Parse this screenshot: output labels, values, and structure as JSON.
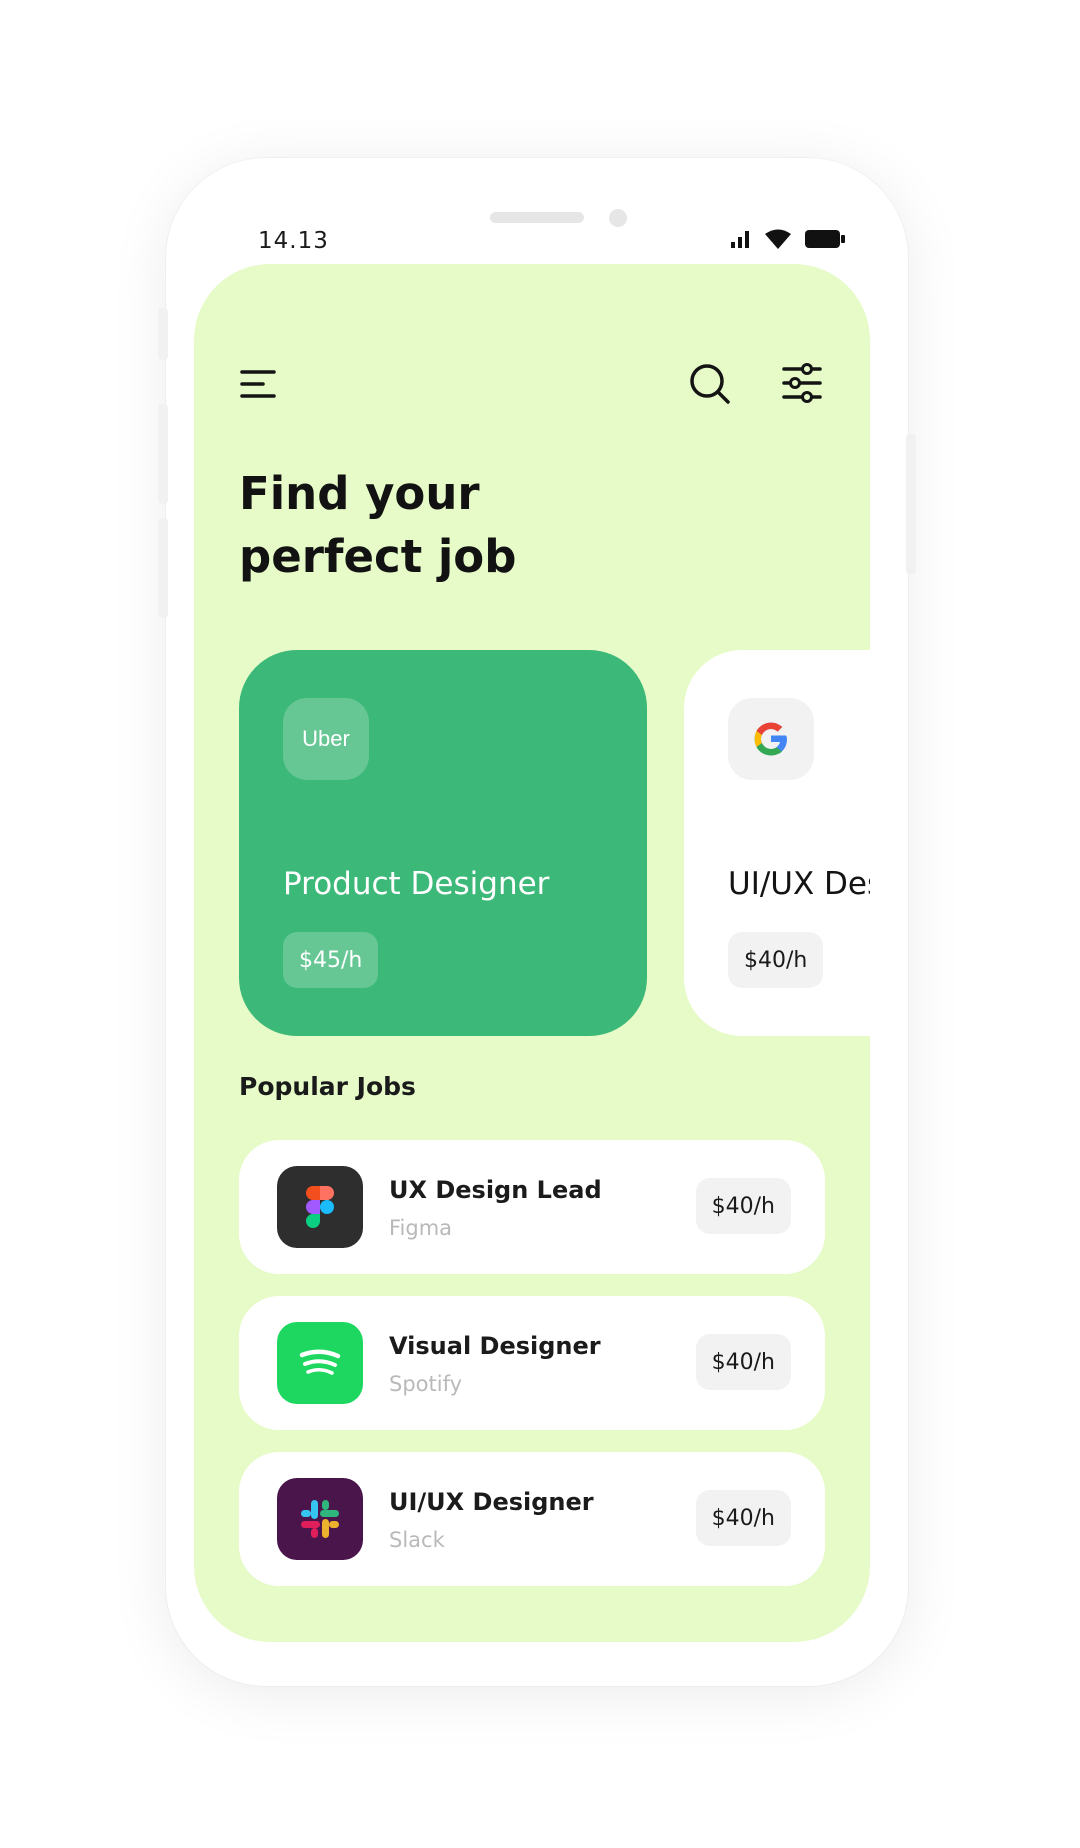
{
  "status_bar": {
    "time": "14.13",
    "icons": [
      "signal-icon",
      "wifi-icon",
      "battery-icon"
    ]
  },
  "header": {
    "menu_icon": "menu-icon",
    "search_icon": "search-icon",
    "filter_icon": "sliders-icon"
  },
  "hero": {
    "title_line1": "Find your",
    "title_line2": "perfect job"
  },
  "featured_jobs": [
    {
      "company_logo_text": "Uber",
      "role": "Product Designer",
      "rate": "$45/h",
      "card_color": "#3cb878"
    },
    {
      "company_logo": "google-logo-icon",
      "role": "UI/UX Designer",
      "rate": "$40/h",
      "card_color": "#ffffff"
    }
  ],
  "popular": {
    "section_title": "Popular Jobs",
    "jobs": [
      {
        "title": "UX Design Lead",
        "company": "Figma",
        "rate": "$40/h",
        "logo": "figma-logo-icon",
        "logo_bg": "#2e2e2e"
      },
      {
        "title": "Visual Designer",
        "company": "Spotify",
        "rate": "$40/h",
        "logo": "spotify-logo-icon",
        "logo_bg": "#1ed760"
      },
      {
        "title": "UI/UX Designer",
        "company": "Slack",
        "rate": "$40/h",
        "logo": "slack-logo-icon",
        "logo_bg": "#4a154b"
      }
    ]
  },
  "colors": {
    "screen_bg": "#e6fbc7",
    "accent_green": "#3cb878",
    "card_white": "#ffffff"
  }
}
